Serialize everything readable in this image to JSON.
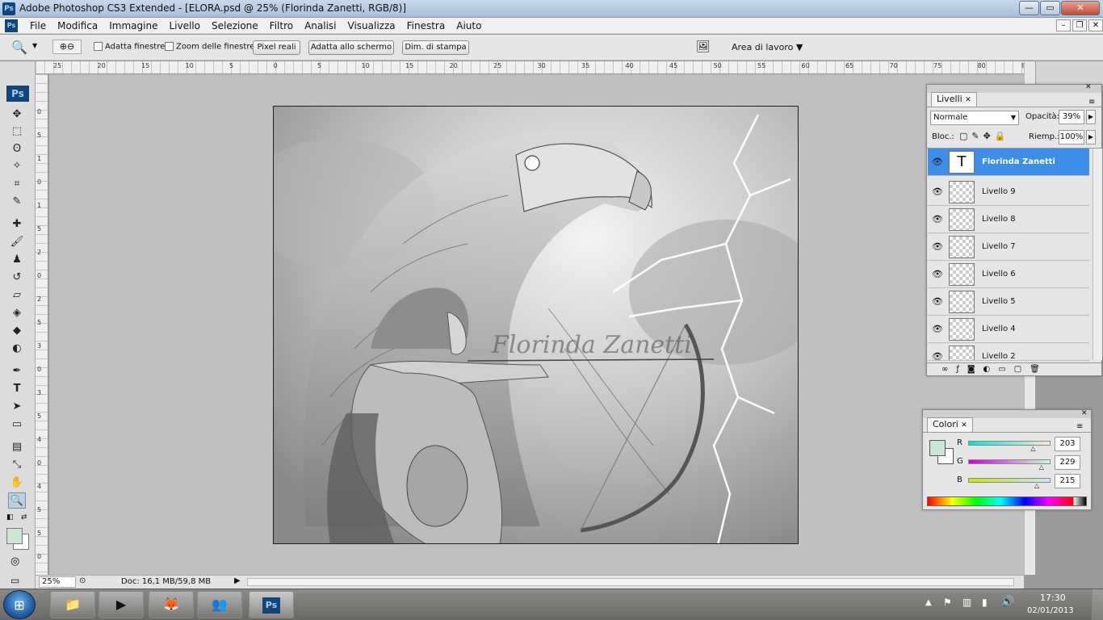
{
  "window": {
    "title": "Adobe Photoshop CS3 Extended - [ELORA.psd @ 25% (Florinda Zanetti, RGB/8)]",
    "app_icon_label": "Ps",
    "min_label": "—",
    "max_label": "▭",
    "close_label": "✕"
  },
  "menu": {
    "items": [
      "File",
      "Modifica",
      "Immagine",
      "Livello",
      "Selezione",
      "Filtro",
      "Analisi",
      "Visualizza",
      "Finestra",
      "Aiuto"
    ],
    "doc_min": "–",
    "doc_max": "❐",
    "doc_close": "✕"
  },
  "options": {
    "adatta_finestre": "Adatta finestre",
    "zoom_finestre": "Zoom delle finestre",
    "pixel_reali": "Pixel reali",
    "adatta_schermo": "Adatta allo schermo",
    "dim_stampa": "Dim. di stampa",
    "area_lavoro": "Area di lavoro ▼"
  },
  "toolbox": {
    "logo": "Ps"
  },
  "ruler_top": [
    "25",
    "20",
    "15",
    "10",
    "5",
    "0",
    "5",
    "10",
    "15",
    "20",
    "25",
    "30",
    "35",
    "40",
    "45",
    "50",
    "55",
    "60",
    "65",
    "70",
    "75",
    "80",
    "8"
  ],
  "ruler_left": [
    "0",
    "5",
    "1",
    "0",
    "1",
    "5",
    "2",
    "0",
    "2",
    "5",
    "3",
    "0",
    "3",
    "5",
    "4",
    "0",
    "4",
    "5",
    "5",
    "0"
  ],
  "canvas": {
    "watermark": "Florinda Zanetti"
  },
  "status": {
    "zoom": "25%",
    "doc": "Doc: 16,1 MB/59,8 MB"
  },
  "layers_panel": {
    "tab": "Livelli",
    "blend_mode": "Normale",
    "opacity_label": "Opacità:",
    "opacity_value": "39%",
    "lock_label": "Bloc.:",
    "fill_label": "Riemp.:",
    "fill_value": "100%",
    "layers": [
      {
        "name": "Florinda Zanetti",
        "selected": true,
        "is_text": true,
        "thumb_text": "T"
      },
      {
        "name": "Livello 9"
      },
      {
        "name": "Livello 8"
      },
      {
        "name": "Livello 7"
      },
      {
        "name": "Livello 6"
      },
      {
        "name": "Livello 5"
      },
      {
        "name": "Livello 4"
      },
      {
        "name": "Livello 2"
      }
    ],
    "footer_icons": [
      "link-icon",
      "fx-icon",
      "mask-icon",
      "adjustment-icon",
      "group-icon",
      "new-layer-icon",
      "trash-icon"
    ]
  },
  "color_panel": {
    "tab": "Colori",
    "r_label": "R",
    "g_label": "G",
    "b_label": "B",
    "r_value": "203",
    "g_value": "229",
    "b_value": "215",
    "fg_color": "#cbe5d7"
  },
  "taskbar": {
    "clock_time": "17:30",
    "clock_date": "02/01/2013",
    "ps_label": "Ps"
  },
  "colors": {
    "selection": "#3d8ee8",
    "ps_blue": "#13447a"
  }
}
